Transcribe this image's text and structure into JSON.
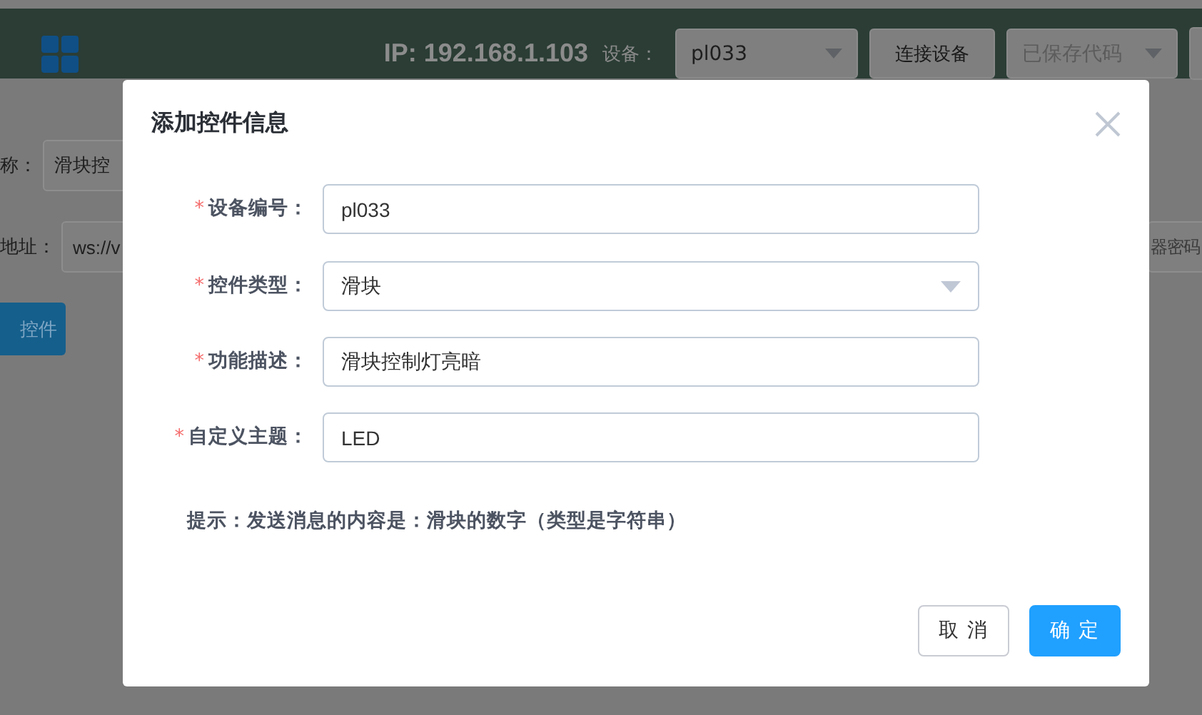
{
  "header": {
    "ip": "IP: 192.168.1.103",
    "device_label": "设备：",
    "device_select": "pl033",
    "connect_button": "连接设备",
    "saved_code_select": "已保存代码"
  },
  "background_form": {
    "name_label": "称：",
    "name_value": "滑块控",
    "address_label": "地址：",
    "address_value": "ws://v",
    "password_value": "器密码",
    "add_button": "控件"
  },
  "dialog": {
    "title": "添加控件信息",
    "fields": [
      {
        "kind": "input",
        "required_mark": "*",
        "label": "设备编号：",
        "value": "pl033"
      },
      {
        "kind": "select",
        "required_mark": "*",
        "label": "控件类型：",
        "value": "滑块"
      },
      {
        "kind": "input",
        "required_mark": "*",
        "label": "功能描述：",
        "value": "滑块控制灯亮暗"
      },
      {
        "kind": "input",
        "required_mark": "*",
        "label": "自定义主题：",
        "value": "LED"
      }
    ],
    "hint": "提示：发送消息的内容是：滑块的数字（类型是字符串）",
    "cancel_button": "取 消",
    "confirm_button": "确 定"
  }
}
